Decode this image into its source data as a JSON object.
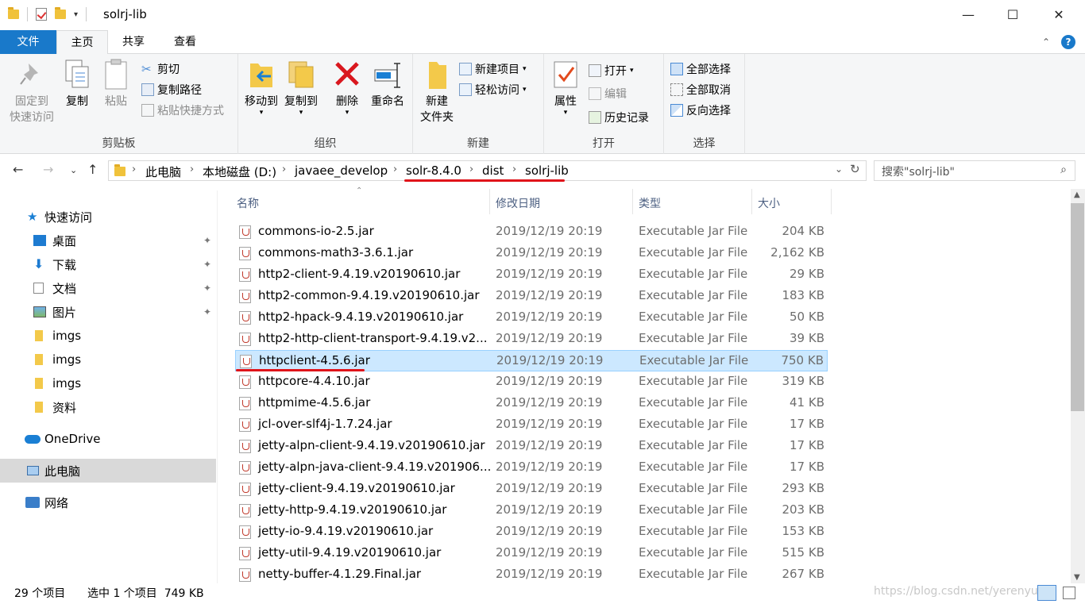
{
  "window": {
    "title": "solrj-lib",
    "minimize": "—",
    "maximize": "☐",
    "close": "✕"
  },
  "tabs": {
    "file": "文件",
    "home": "主页",
    "share": "共享",
    "view": "查看"
  },
  "ribbon": {
    "clipboard": {
      "label": "剪贴板",
      "pin": "固定到\n快速访问",
      "pin_l1": "固定到",
      "pin_l2": "快速访问",
      "copy": "复制",
      "paste": "粘贴",
      "cut": "剪切",
      "copy_path": "复制路径",
      "paste_shortcut": "粘贴快捷方式"
    },
    "organize": {
      "label": "组织",
      "move_to": "移动到",
      "copy_to": "复制到",
      "delete": "删除",
      "rename": "重命名"
    },
    "new": {
      "label": "新建",
      "new_folder_l1": "新建",
      "new_folder_l2": "文件夹",
      "new_item": "新建项目",
      "easy_access": "轻松访问"
    },
    "open": {
      "label": "打开",
      "properties": "属性",
      "open": "打开",
      "edit": "编辑",
      "history": "历史记录"
    },
    "select": {
      "label": "选择",
      "select_all": "全部选择",
      "select_none": "全部取消",
      "invert": "反向选择"
    }
  },
  "address": {
    "crumbs": [
      "此电脑",
      "本地磁盘 (D:)",
      "javaee_develop",
      "solr-8.4.0",
      "dist",
      "solrj-lib"
    ]
  },
  "search": {
    "placeholder": "搜索\"solrj-lib\""
  },
  "sidebar": {
    "quick_access": "快速访问",
    "items": [
      "桌面",
      "下载",
      "文档",
      "图片",
      "imgs",
      "imgs",
      "imgs",
      "资料"
    ],
    "onedrive": "OneDrive",
    "this_pc": "此电脑",
    "network": "网络"
  },
  "columns": {
    "name": "名称",
    "date": "修改日期",
    "type": "类型",
    "size": "大小"
  },
  "files": [
    {
      "name": "commons-io-2.5.jar",
      "date": "2019/12/19 20:19",
      "type": "Executable Jar File",
      "size": "204 KB"
    },
    {
      "name": "commons-math3-3.6.1.jar",
      "date": "2019/12/19 20:19",
      "type": "Executable Jar File",
      "size": "2,162 KB"
    },
    {
      "name": "http2-client-9.4.19.v20190610.jar",
      "date": "2019/12/19 20:19",
      "type": "Executable Jar File",
      "size": "29 KB"
    },
    {
      "name": "http2-common-9.4.19.v20190610.jar",
      "date": "2019/12/19 20:19",
      "type": "Executable Jar File",
      "size": "183 KB"
    },
    {
      "name": "http2-hpack-9.4.19.v20190610.jar",
      "date": "2019/12/19 20:19",
      "type": "Executable Jar File",
      "size": "50 KB"
    },
    {
      "name": "http2-http-client-transport-9.4.19.v2...",
      "date": "2019/12/19 20:19",
      "type": "Executable Jar File",
      "size": "39 KB"
    },
    {
      "name": "httpclient-4.5.6.jar",
      "date": "2019/12/19 20:19",
      "type": "Executable Jar File",
      "size": "750 KB"
    },
    {
      "name": "httpcore-4.4.10.jar",
      "date": "2019/12/19 20:19",
      "type": "Executable Jar File",
      "size": "319 KB"
    },
    {
      "name": "httpmime-4.5.6.jar",
      "date": "2019/12/19 20:19",
      "type": "Executable Jar File",
      "size": "41 KB"
    },
    {
      "name": "jcl-over-slf4j-1.7.24.jar",
      "date": "2019/12/19 20:19",
      "type": "Executable Jar File",
      "size": "17 KB"
    },
    {
      "name": "jetty-alpn-client-9.4.19.v20190610.jar",
      "date": "2019/12/19 20:19",
      "type": "Executable Jar File",
      "size": "17 KB"
    },
    {
      "name": "jetty-alpn-java-client-9.4.19.v201906...",
      "date": "2019/12/19 20:19",
      "type": "Executable Jar File",
      "size": "17 KB"
    },
    {
      "name": "jetty-client-9.4.19.v20190610.jar",
      "date": "2019/12/19 20:19",
      "type": "Executable Jar File",
      "size": "293 KB"
    },
    {
      "name": "jetty-http-9.4.19.v20190610.jar",
      "date": "2019/12/19 20:19",
      "type": "Executable Jar File",
      "size": "203 KB"
    },
    {
      "name": "jetty-io-9.4.19.v20190610.jar",
      "date": "2019/12/19 20:19",
      "type": "Executable Jar File",
      "size": "153 KB"
    },
    {
      "name": "jetty-util-9.4.19.v20190610.jar",
      "date": "2019/12/19 20:19",
      "type": "Executable Jar File",
      "size": "515 KB"
    },
    {
      "name": "netty-buffer-4.1.29.Final.jar",
      "date": "2019/12/19 20:19",
      "type": "Executable Jar File",
      "size": "267 KB"
    }
  ],
  "status": {
    "count": "29 个项目",
    "selected": "选中 1 个项目  749 KB"
  },
  "watermark": "https://blog.csdn.net/yerenyu"
}
